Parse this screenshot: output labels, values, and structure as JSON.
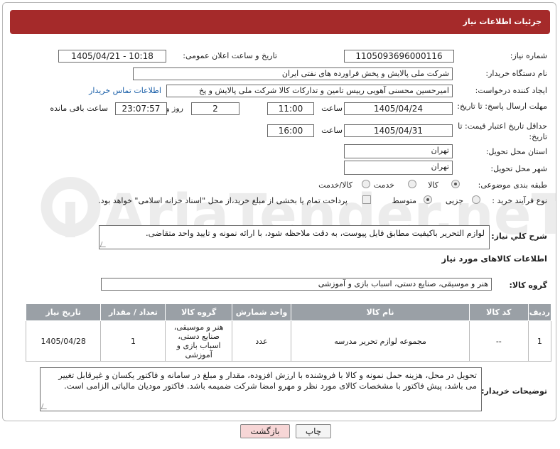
{
  "header": {
    "title": "جزئیات اطلاعات نیاز"
  },
  "fields": {
    "need_number_label": "شماره نیاز:",
    "need_number": "1105093696000116",
    "announce_label": "تاریخ و ساعت اعلان عمومی:",
    "announce_value": "1405/04/21 - 10:18",
    "buyer_org_label": "نام دستگاه خریدار:",
    "buyer_org": "شرکت ملی پالایش و پخش فراورده های نفتی ایران",
    "requester_label": "ایجاد کننده درخواست:",
    "requester": "امیرحسین محسنی آهویی رییس تامین و تدارکات کالا شرکت ملی پالایش و پخ",
    "contact_link": "اطلاعات تماس خریدار",
    "reply_deadline_label": "مهلت ارسال پاسخ: تا تاریخ:",
    "reply_date": "1405/04/24",
    "time_label": "ساعت",
    "reply_time": "11:00",
    "days_value": "2",
    "days_label": "روز و",
    "remaining_time": "23:07:57",
    "remaining_label": "ساعت باقی مانده",
    "price_validity_label": "حداقل تاریخ اعتبار قیمت: تا تاریخ:",
    "validity_date": "1405/04/31",
    "validity_time": "16:00",
    "province_label": "استان محل تحویل:",
    "province": "تهران",
    "city_label": "شهر محل تحویل:",
    "city": "تهران",
    "category_label": "طبقه بندی موضوعی:",
    "category_options": [
      "کالا",
      "خدمت",
      "کالا/خدمت"
    ],
    "process_label": "نوع فرآیند خرید :",
    "process_options": [
      "جزیی",
      "متوسط"
    ],
    "payment_note": "پرداخت تمام یا بخشی از مبلغ خرید،از محل \"اسناد خزانه اسلامی\" خواهد بود."
  },
  "description": {
    "label": "شرح کلي نياز:",
    "text": "لوازم التحریر باکیفیت مطابق فایل پیوست، به دقت ملاحظه شود، با ارائه نمونه و تایید واحد متقاضی."
  },
  "goods_section": {
    "title": "اطلاعات کالاهای مورد نیاز",
    "group_label": "گروه کالا:",
    "group_value": "هنر و موسیقی، صنایع دستی، اسباب بازی و آموزشی"
  },
  "table": {
    "headers": [
      "ردیف",
      "کد کالا",
      "نام کالا",
      "واحد شمارش",
      "گروه کالا",
      "تعداد / مقدار",
      "تاریخ نیاز"
    ],
    "rows": [
      [
        "1",
        "--",
        "مجموعه لوازم تحریر مدرسه",
        "عدد",
        "هنر و موسیقی، صنایع دستی، اسباب بازی و آموزشی",
        "1",
        "1405/04/28"
      ]
    ]
  },
  "buyer_notes": {
    "label": "توضیحات خریدار:",
    "text": "تحویل در محل، هزینه حمل نمونه و کالا با فروشنده با ارزش افزوده، مقدار و مبلغ در سامانه و فاکتور یکسان و غیرقابل تغییر می باشد، پیش فاکتور با مشخصات کالای مورد نظر و مهرو امضا شرکت ضمیمه باشد. فاکتور مودیان مالیاتی الزامی است."
  },
  "buttons": {
    "print": "چاپ",
    "back": "بازگشت"
  },
  "watermark_text": "AriaTender.neT",
  "colors": {
    "header": "#a52a2a",
    "link": "#1a5fa8",
    "back_button": "#f7d6d6"
  }
}
